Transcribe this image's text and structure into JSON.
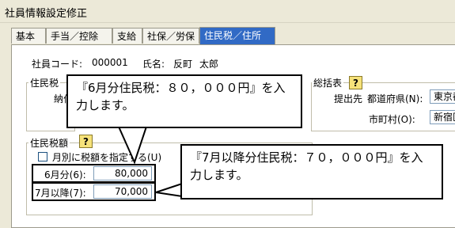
{
  "window": {
    "title": "社員情報設定修正"
  },
  "tabs": [
    "基本",
    "手当／控除",
    "支給",
    "社保／労保",
    "住民税／住所"
  ],
  "employee": {
    "code_label": "社員コード:",
    "code_value": "000001",
    "name_label": "氏名:",
    "last_name": "反町",
    "first_name": "太郎"
  },
  "resident_tax_group": {
    "title": "住民税",
    "partial_label": "納付"
  },
  "summary_group": {
    "title": "総括表",
    "submit_label": "提出先",
    "prefecture_label": "都道府県(N):",
    "prefecture_value": "東京都",
    "city_label": "市町村(O):",
    "city_value": "新宿区"
  },
  "tax_amount_group": {
    "title": "住民税額",
    "monthly_checkbox_label": "月別に税額を指定する(U)",
    "june_label": "6月分(6):",
    "june_value": "80,000",
    "july_label": "7月以降(7):",
    "july_value": "70,000"
  },
  "callouts": {
    "june": "『6月分住民税：８０，０００円』を入力します。",
    "july": "『7月以降分住民税：７０，０００円』を入力します。"
  },
  "icons": {
    "help": "?"
  }
}
